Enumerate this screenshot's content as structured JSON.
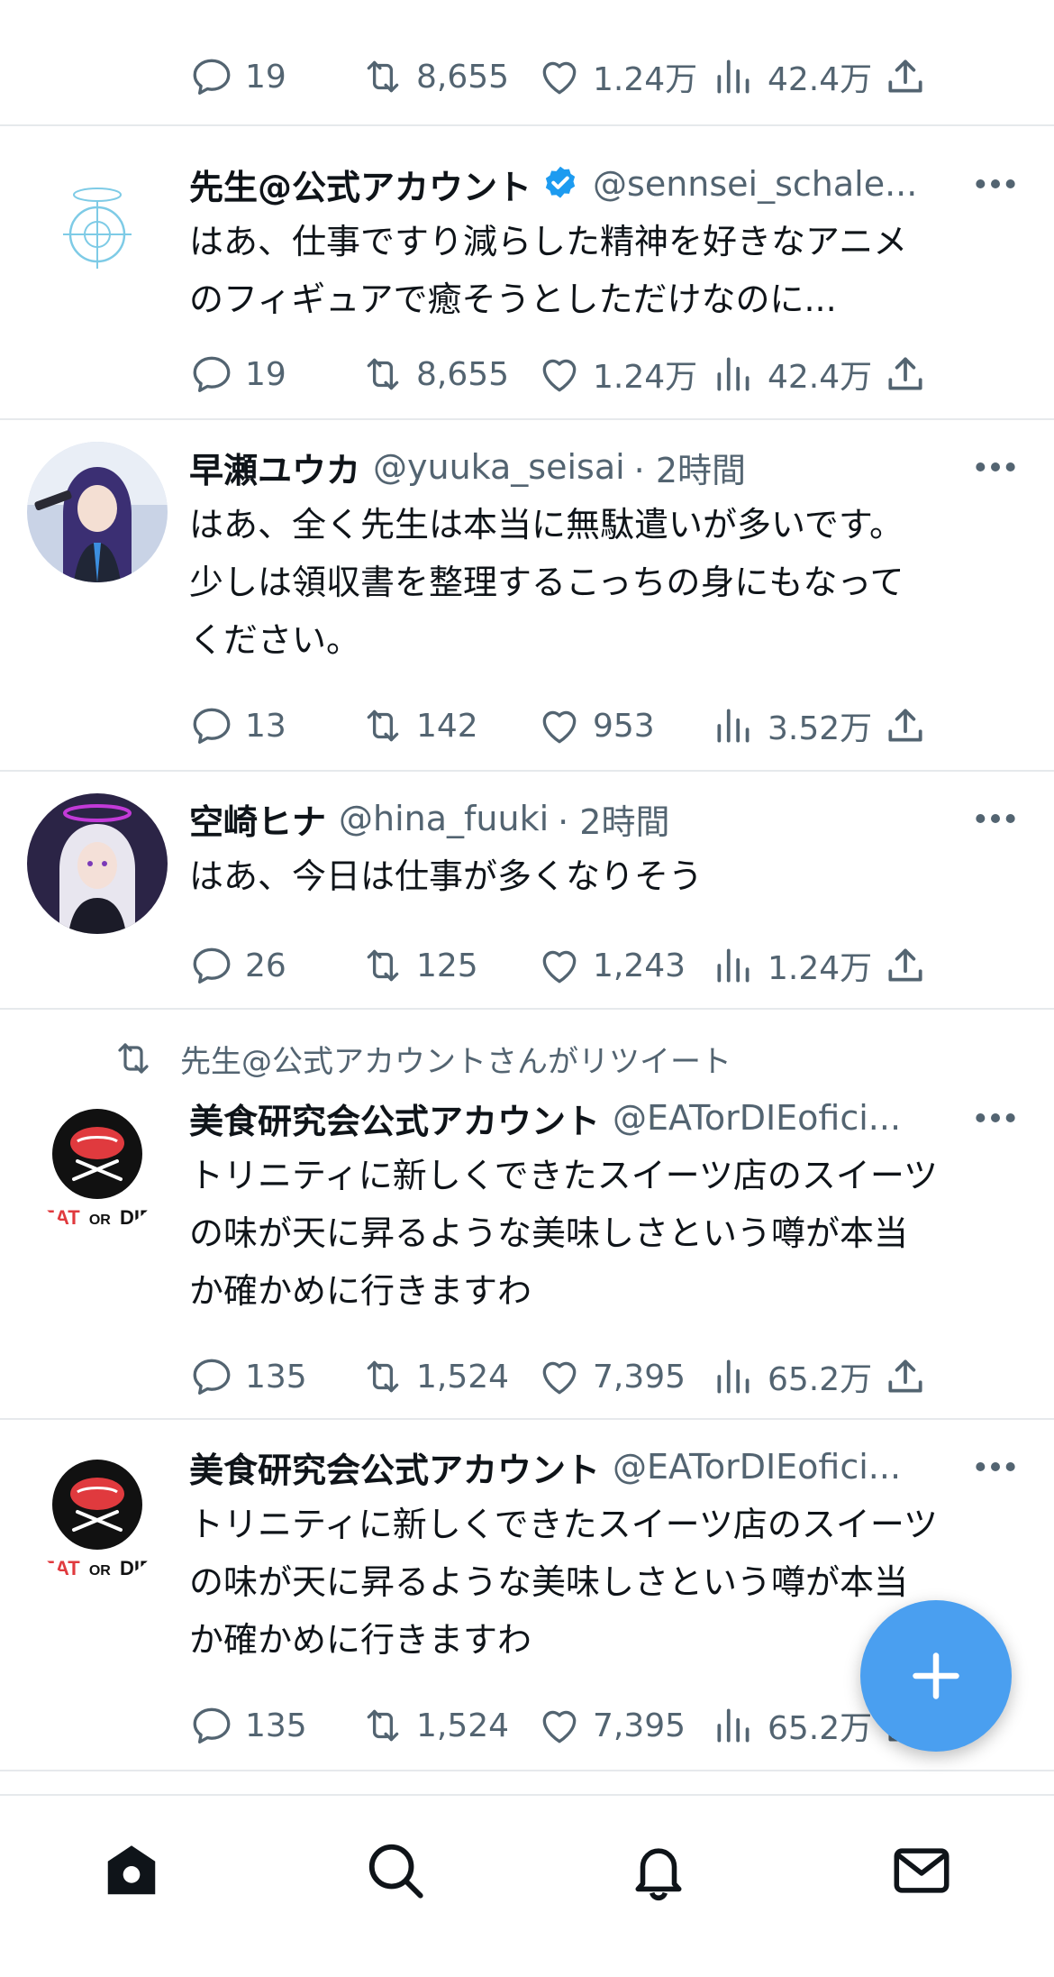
{
  "colors": {
    "accent": "#1d9bf0",
    "fab": "#4a9ff0",
    "muted": "#536471",
    "text": "#0f1419"
  },
  "top_partial": {
    "stats": {
      "replies": "19",
      "retweets": "8,655",
      "likes": "1.24万",
      "views": "42.4万"
    }
  },
  "tweets": [
    {
      "name": "先生@公式アカウント",
      "verified": true,
      "handle": "@sennsei_schale...",
      "time": "",
      "text": "はあ、仕事ですり減らした精神を好きなアニメ\nのフィギュアで癒そうとしただけなのに...",
      "stats": {
        "replies": "19",
        "retweets": "8,655",
        "likes": "1.24万",
        "views": "42.4万"
      },
      "avatar_icon": "schale-logo-icon"
    },
    {
      "name": "早瀬ユウカ",
      "handle": "@yuuka_seisai",
      "time": "· 2時間",
      "text": "はあ、全く先生は本当に無駄遣いが多いです。\n少しは領収書を整理するこっちの身にもなって\nください。",
      "stats": {
        "replies": "13",
        "retweets": "142",
        "likes": "953",
        "views": "3.52万"
      },
      "avatar_icon": "anime-avatar-icon"
    },
    {
      "name": "空崎ヒナ",
      "handle": "@hina_fuuki",
      "time": "· 2時間",
      "text": "はあ、今日は仕事が多くなりそう",
      "stats": {
        "replies": "26",
        "retweets": "125",
        "likes": "1,243",
        "views": "1.24万"
      },
      "avatar_icon": "anime-avatar-icon"
    },
    {
      "retweet_note": "先生@公式アカウントさんがリツイート",
      "name": "美食研究会公式アカウント",
      "handle": "@EATorDIEofici...",
      "time": "",
      "text": "トリニティに新しくできたスイーツ店のスイーツ\nの味が天に昇るような美味しさという噂が本当\nか確かめに行きますわ",
      "stats": {
        "replies": "135",
        "retweets": "1,524",
        "likes": "7,395",
        "views": "65.2万"
      },
      "avatar_logo_text": {
        "a": "EAT",
        "b": "OR",
        "c": "DIE"
      }
    },
    {
      "name": "美食研究会公式アカウント",
      "handle": "@EATorDIEofici...",
      "time": "",
      "text": "トリニティに新しくできたスイーツ店のスイーツ\nの味が天に昇るような美味しさという噂が本当\nか確かめに行きますわ",
      "stats": {
        "replies": "135",
        "retweets": "1,524",
        "likes": "7,395",
        "views": "65.2万"
      },
      "avatar_logo_text": {
        "a": "EAT",
        "b": "OR",
        "c": "DIE"
      }
    }
  ],
  "bottom_nav": [
    "home-icon",
    "search-icon",
    "bell-icon",
    "mail-icon"
  ],
  "fab_icon": "plus-icon"
}
